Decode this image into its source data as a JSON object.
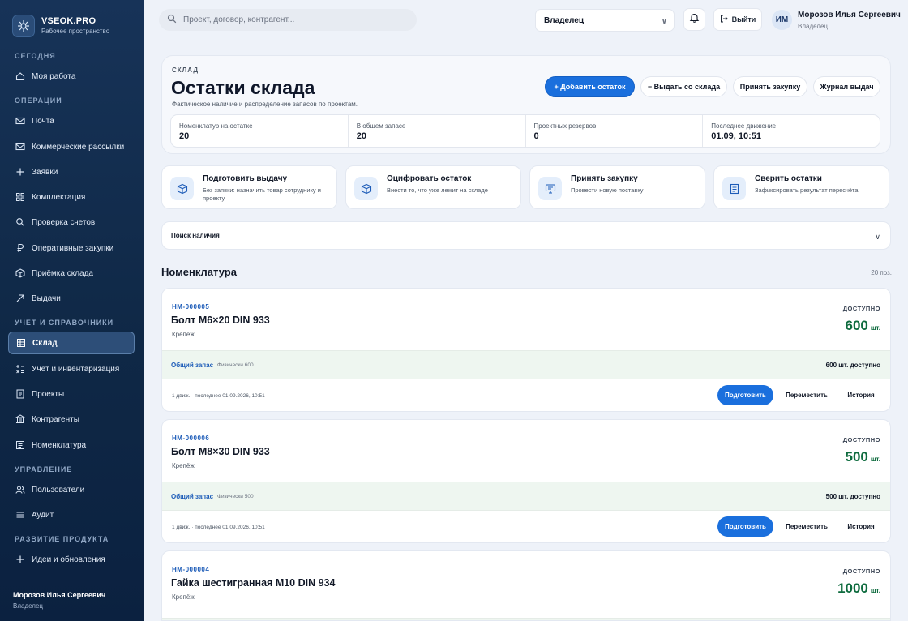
{
  "brand": {
    "name": "VSEOK.PRO",
    "subtitle": "Рабочее пространство"
  },
  "sidebar": {
    "sections": [
      "СЕГОДНЯ",
      "ОПЕРАЦИИ",
      "УЧЁТ И СПРАВОЧНИКИ",
      "УПРАВЛЕНИЕ",
      "РАЗВИТИЕ ПРОДУКТА"
    ],
    "items": [
      {
        "label": "Моя работа",
        "icon": "home-icon"
      },
      {
        "label": "Почта",
        "icon": "mail-icon"
      },
      {
        "label": "Коммерческие рассылки",
        "icon": "mail-icon"
      },
      {
        "label": "Заявки",
        "icon": "plus-icon"
      },
      {
        "label": "Комплектация",
        "icon": "grid-icon"
      },
      {
        "label": "Проверка счетов",
        "icon": "search-icon"
      },
      {
        "label": "Оперативные закупки",
        "icon": "ruble-icon"
      },
      {
        "label": "Приёмка склада",
        "icon": "box-icon"
      },
      {
        "label": "Выдачи",
        "icon": "arrow-icon"
      },
      {
        "label": "Склад",
        "icon": "warehouse-icon",
        "active": true
      },
      {
        "label": "Учёт и инвентаризация",
        "icon": "calc-icon"
      },
      {
        "label": "Проекты",
        "icon": "document-icon"
      },
      {
        "label": "Контрагенты",
        "icon": "bank-icon"
      },
      {
        "label": "Номенклатура",
        "icon": "list-icon"
      },
      {
        "label": "Пользователи",
        "icon": "users-icon"
      },
      {
        "label": "Аудит",
        "icon": "menu-icon"
      },
      {
        "label": "Идеи и обновления",
        "icon": "plus-icon"
      }
    ],
    "user": {
      "name": "Морозов Илья Сергеевич",
      "role": "Владелец"
    }
  },
  "topbar": {
    "search_placeholder": "Проект, договор, контрагент...",
    "role_select": "Владелец",
    "logout_label": "Выйти",
    "avatar_initials": "ИМ",
    "user_name": "Морозов Илья Сергеевич",
    "user_role": "Владелец"
  },
  "header": {
    "eyebrow": "СКЛАД",
    "title": "Остатки склада",
    "subtitle": "Фактическое наличие и распределение запасов по проектам.",
    "buttons": {
      "add": "+ Добавить остаток",
      "issue": "− Выдать со склада",
      "accept": "Принять закупку",
      "journal": "Журнал выдач"
    },
    "stats": [
      {
        "label": "Номенклатур на остатке",
        "value": "20"
      },
      {
        "label": "В общем запасе",
        "value": "20"
      },
      {
        "label": "Проектных резервов",
        "value": "0"
      },
      {
        "label": "Последнее движение",
        "value": "01.09, 10:51"
      }
    ]
  },
  "actions": [
    {
      "title": "Подготовить выдачу",
      "desc": "Без заявки: назначить товар сотруднику и проекту",
      "icon": "box-icon"
    },
    {
      "title": "Оцифровать остаток",
      "desc": "Внести то, что уже лежит на складе",
      "icon": "cube-icon"
    },
    {
      "title": "Принять закупку",
      "desc": "Провести новую поставку",
      "icon": "monitor-icon"
    },
    {
      "title": "Сверить остатки",
      "desc": "Зафиксировать результат пересчёта",
      "icon": "clipboard-icon"
    }
  ],
  "availability": {
    "label": "Поиск наличия"
  },
  "section": {
    "title": "Номенклатура",
    "count": "20 поз."
  },
  "items": [
    {
      "code": "НМ-000005",
      "name": "Болт М6×20 DIN 933",
      "category": "Крепёж",
      "available_label": "ДОСТУПНО",
      "qty": "600",
      "unit": "шт.",
      "stock_label": "Общий запас",
      "physical": "Физически 600",
      "stock_available": "600 шт. доступно",
      "moves": "1 движ. · последнее 01.09.2026, 10:51",
      "btn_prepare": "Подготовить",
      "btn_move": "Переместить",
      "btn_history": "История"
    },
    {
      "code": "НМ-000006",
      "name": "Болт М8×30 DIN 933",
      "category": "Крепёж",
      "available_label": "ДОСТУПНО",
      "qty": "500",
      "unit": "шт.",
      "stock_label": "Общий запас",
      "physical": "Физически 500",
      "stock_available": "500 шт. доступно",
      "moves": "1 движ. · последнее 01.09.2026, 10:51",
      "btn_prepare": "Подготовить",
      "btn_move": "Переместить",
      "btn_history": "История"
    },
    {
      "code": "НМ-000004",
      "name": "Гайка шестигранная М10 DIN 934",
      "category": "Крепёж",
      "available_label": "ДОСТУПНО",
      "qty": "1000",
      "unit": "шт."
    }
  ],
  "colors": {
    "sidebar_bg": "#0f2846",
    "accent": "#1a6fdd",
    "available_green": "#0e6b3e",
    "code_blue": "#1d5cb8"
  }
}
